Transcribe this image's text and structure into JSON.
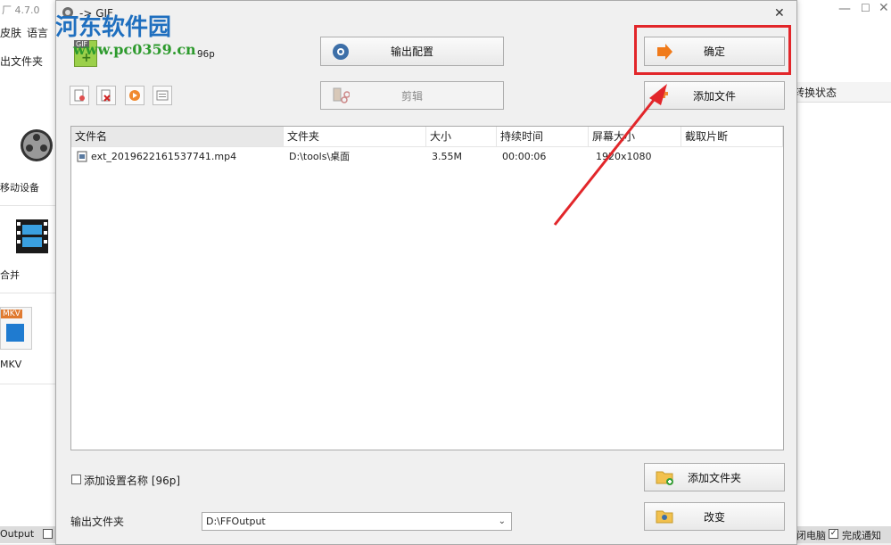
{
  "bg_app": {
    "title_fragment": "厂 4.7.0",
    "menu_items": [
      "皮肤",
      "语言"
    ],
    "toolbar_item": "出文件夹",
    "left_items": [
      "移动设备",
      "合并",
      "MKV"
    ],
    "mkv_badge": "MKV",
    "right_header": "转换状态",
    "status_left": "Output",
    "status_right_1": "闭电脑",
    "status_right_2": "完成通知"
  },
  "watermark": {
    "site_name": "河东软件园",
    "url": "www.pc0359.cn"
  },
  "dialog": {
    "title": "-> GIF",
    "preset_label": "96p",
    "output_config_label": "输出配置",
    "confirm_label": "确定",
    "clip_label": "剪辑",
    "add_file_label": "添加文件",
    "add_folder_label": "添加文件夹",
    "change_label": "改变",
    "add_preset_name_label": "添加设置名称 [96p]",
    "output_folder_label": "输出文件夹",
    "output_folder_value": "D:\\FFOutput",
    "list": {
      "columns": [
        "文件名",
        "文件夹",
        "大小",
        "持续时间",
        "屏幕大小",
        "截取片断"
      ],
      "rows": [
        [
          "ext_2019622161537741.mp4",
          "D:\\tools\\桌面",
          "3.55M",
          "00:00:06",
          "1920x1080",
          ""
        ]
      ]
    }
  },
  "colors": {
    "highlight_red": "#e2262a",
    "watermark_blue": "#1f6fbf",
    "watermark_green": "#2d9a2d"
  }
}
